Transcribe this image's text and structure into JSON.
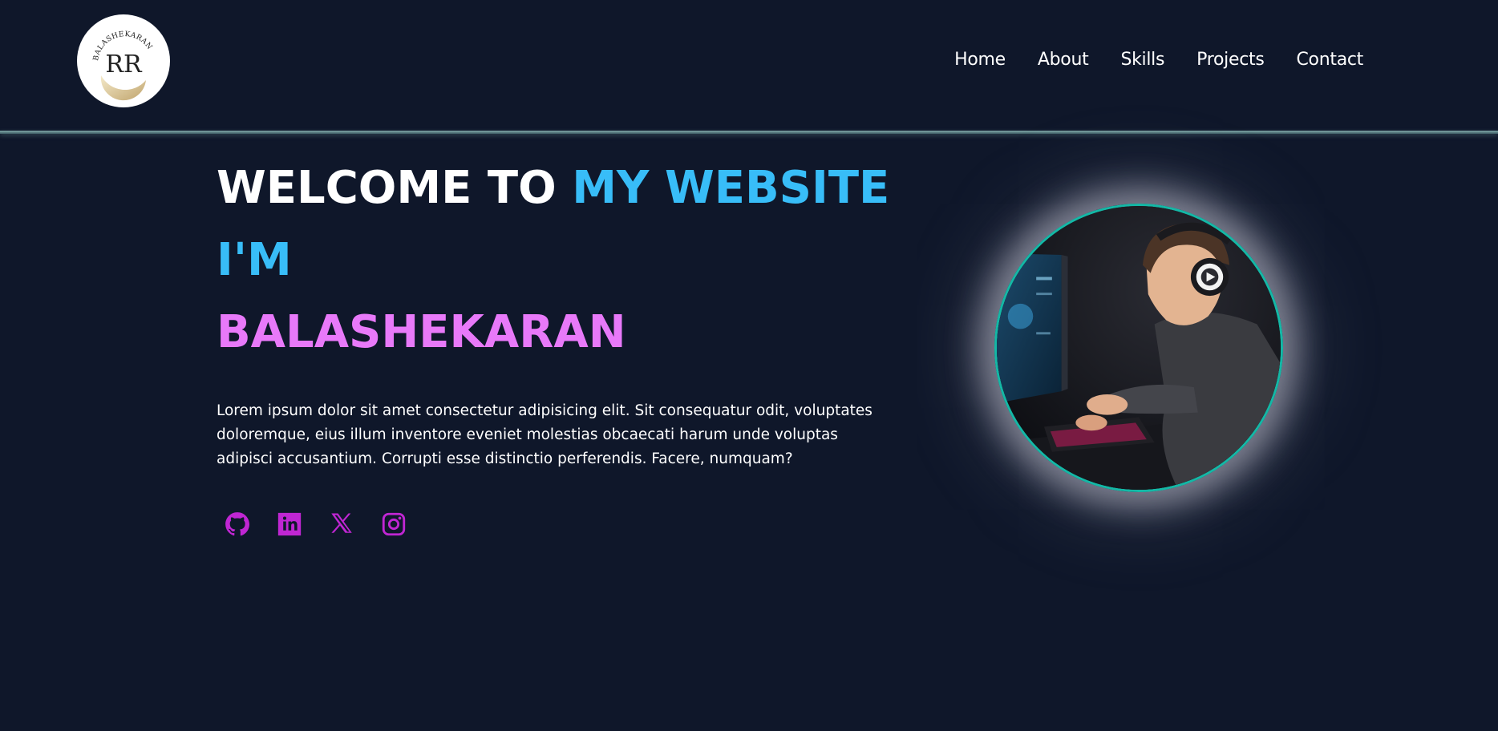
{
  "logo": {
    "text": "BALASHEKARAN",
    "monogram": "RR"
  },
  "nav": [
    {
      "label": "Home"
    },
    {
      "label": "About"
    },
    {
      "label": "Skills"
    },
    {
      "label": "Projects"
    },
    {
      "label": "Contact"
    }
  ],
  "hero": {
    "line1_white": "WELCOME TO ",
    "line1_blue": "MY WEBSITE",
    "line2": "I'M",
    "line3": "BALASHEKARAN",
    "description": "Lorem ipsum dolor sit amet consectetur adipisicing elit. Sit consequatur odit, voluptates doloremque, eius illum inventore eveniet molestias obcaecati harum unde voluptas adipisci accusantium. Corrupti esse distinctio perferendis. Facere, numquam?"
  },
  "socials": [
    {
      "icon": "github-icon"
    },
    {
      "icon": "linkedin-icon"
    },
    {
      "icon": "x-twitter-icon"
    },
    {
      "icon": "instagram-icon"
    }
  ],
  "colors": {
    "background": "#0f172a",
    "accent_blue": "#38bdf8",
    "accent_pink": "#e879f9",
    "social_icon": "#c026d3",
    "avatar_border": "#14b8a6"
  }
}
